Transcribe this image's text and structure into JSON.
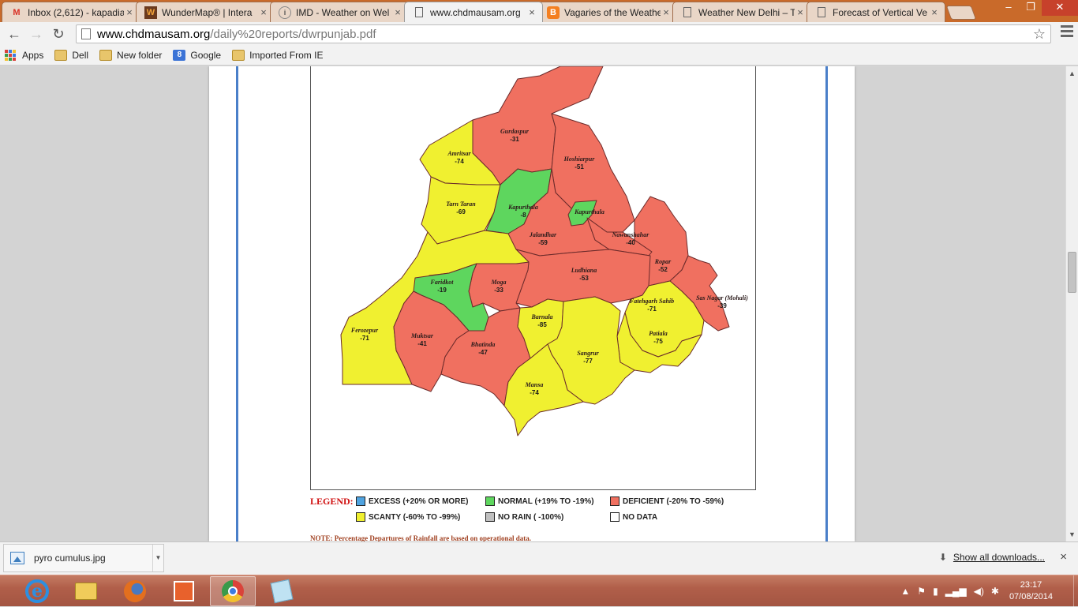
{
  "tabs": [
    {
      "title": "Inbox (2,612) - kapadia",
      "favicon": "gmail-icon",
      "active": false
    },
    {
      "title": "WunderMap® | Intera",
      "favicon": "wundermap-icon",
      "active": false
    },
    {
      "title": "IMD - Weather on Wel",
      "favicon": "imd-icon",
      "active": false
    },
    {
      "title": "www.chdmausam.org",
      "favicon": "document-icon",
      "active": true
    },
    {
      "title": "Vagaries of the Weathe",
      "favicon": "blogger-icon",
      "active": false
    },
    {
      "title": "Weather New Delhi – T",
      "favicon": "document-icon",
      "active": false
    },
    {
      "title": "Forecast of Vertical Ve",
      "favicon": "document-icon",
      "active": false
    }
  ],
  "toolbar": {
    "url_host": "www.chdmausam.org",
    "url_path": "/daily%20reports/dwrpunjab.pdf"
  },
  "bookmarks": [
    {
      "label": "Apps",
      "icon": "apps-grid-icon"
    },
    {
      "label": "Dell",
      "icon": "folder-icon"
    },
    {
      "label": "New folder",
      "icon": "folder-icon"
    },
    {
      "label": "Google",
      "icon": "google-icon"
    },
    {
      "label": "Imported From IE",
      "icon": "folder-icon"
    }
  ],
  "map": {
    "colors": {
      "excess": "#4fa3e0",
      "normal": "#5ed65e",
      "deficient": "#f07060",
      "scanty": "#f0f030",
      "no_rain": "#c0c0c0",
      "no_data": "#ffffff"
    },
    "districts": [
      {
        "name": "Gurdaspur",
        "value": "-31"
      },
      {
        "name": "Amritsar",
        "value": "-74"
      },
      {
        "name": "Hoshiarpur",
        "value": "-51"
      },
      {
        "name": "Tarn Taran",
        "value": "-69"
      },
      {
        "name": "Kapurthala",
        "value": "-8"
      },
      {
        "name": "Kapurthala",
        "value": ""
      },
      {
        "name": "Jalandhar",
        "value": "-59"
      },
      {
        "name": "Nawanshahar",
        "value": "-40"
      },
      {
        "name": "Ropar",
        "value": "-52"
      },
      {
        "name": "Ludhiana",
        "value": "-53"
      },
      {
        "name": "Moga",
        "value": "-33"
      },
      {
        "name": "Faridkot",
        "value": "-19"
      },
      {
        "name": "Sas Nagar (Mohali)",
        "value": "-39"
      },
      {
        "name": "Fatehgarh Sahib",
        "value": "-71"
      },
      {
        "name": "Ferozepur",
        "value": "-71"
      },
      {
        "name": "Muktsar",
        "value": "-41"
      },
      {
        "name": "Bhatinda",
        "value": "-47"
      },
      {
        "name": "Barnala",
        "value": "-85"
      },
      {
        "name": "Patiala",
        "value": "-75"
      },
      {
        "name": "Sangrur",
        "value": "-77"
      },
      {
        "name": "Mansa",
        "value": "-74"
      }
    ]
  },
  "legend": {
    "title": "LEGEND:",
    "items": [
      {
        "label": "EXCESS (+20% OR MORE)",
        "color": "#4fa3e0"
      },
      {
        "label": "NORMAL (+19%  TO -19%)",
        "color": "#5ed65e"
      },
      {
        "label": "DEFICIENT (-20%  TO -59%)",
        "color": "#f07060"
      },
      {
        "label": "SCANTY (-60%  TO -99%)",
        "color": "#f0f030"
      },
      {
        "label": "NO RAIN ( -100%)",
        "color": "#c0c0c0"
      },
      {
        "label": "NO DATA",
        "color": "#ffffff"
      }
    ],
    "note": "NOTE: Percentage Departures of Rainfall are based on operational data."
  },
  "downloads": {
    "file": "pyro cumulus.jpg",
    "show_all": "Show all downloads..."
  },
  "taskbar": {
    "apps": [
      "internet-explorer-icon",
      "file-explorer-icon",
      "firefox-icon",
      "office-icon",
      "chrome-icon",
      "notepad-icon"
    ],
    "time": "23:17",
    "date": "07/08/2014"
  }
}
